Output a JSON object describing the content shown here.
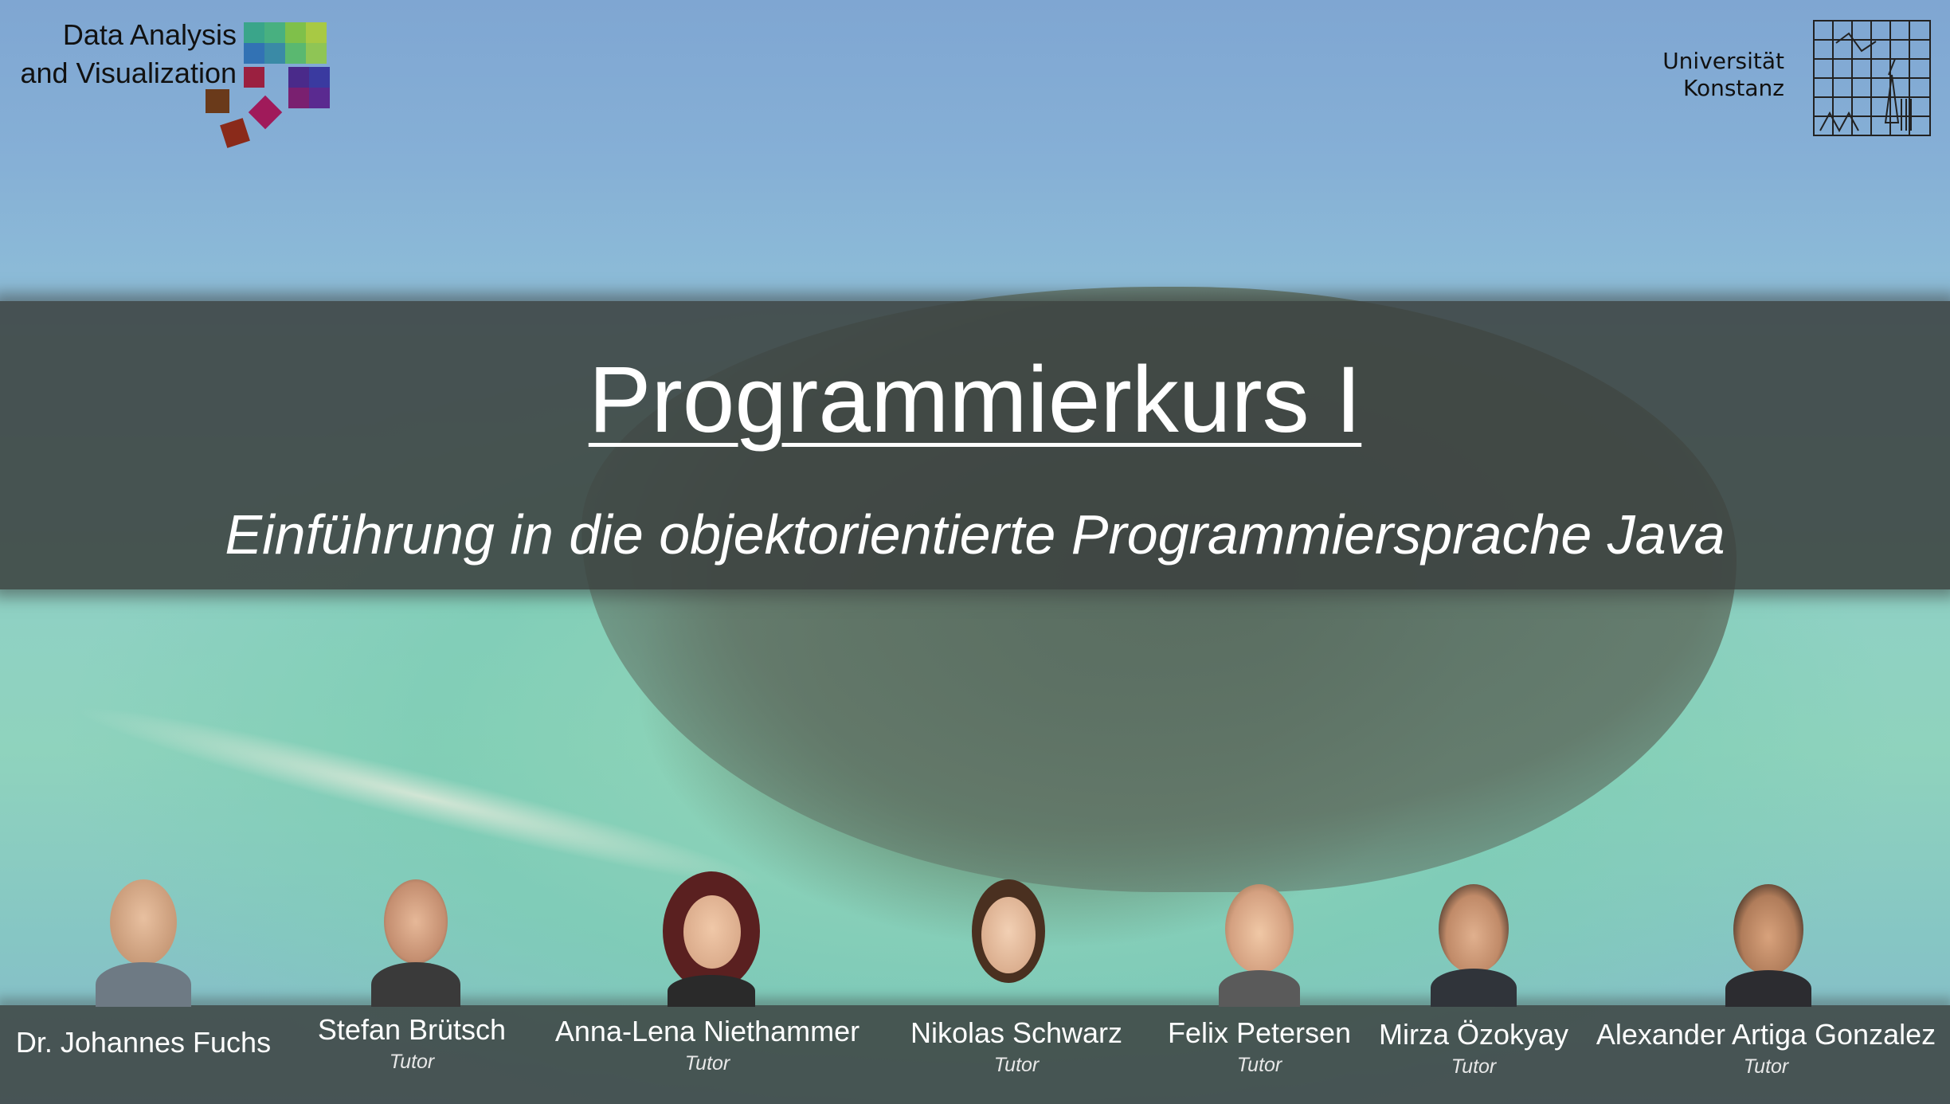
{
  "brand": {
    "lab_line1": "Data Analysis",
    "lab_line2": "and Visualization",
    "uni_line1": "Universität",
    "uni_line2": "Konstanz"
  },
  "slide": {
    "title": "Programmierkurs I",
    "subtitle": "Einführung in die objektorientierte Programmiersprache Java"
  },
  "people": [
    {
      "name": "Dr. Johannes Fuchs",
      "role": ""
    },
    {
      "name": "Stefan Brütsch",
      "role": "Tutor"
    },
    {
      "name": "Anna-Lena Niethammer",
      "role": "Tutor"
    },
    {
      "name": "Nikolas Schwarz",
      "role": "Tutor"
    },
    {
      "name": "Felix Petersen",
      "role": "Tutor"
    },
    {
      "name": "Mirza Özokyay",
      "role": "Tutor"
    },
    {
      "name": "Alexander Artiga Gonzalez",
      "role": "Tutor"
    }
  ],
  "colors": {
    "band": "#3c4240",
    "text_light": "#ffffff",
    "logo_text": "#111111"
  }
}
